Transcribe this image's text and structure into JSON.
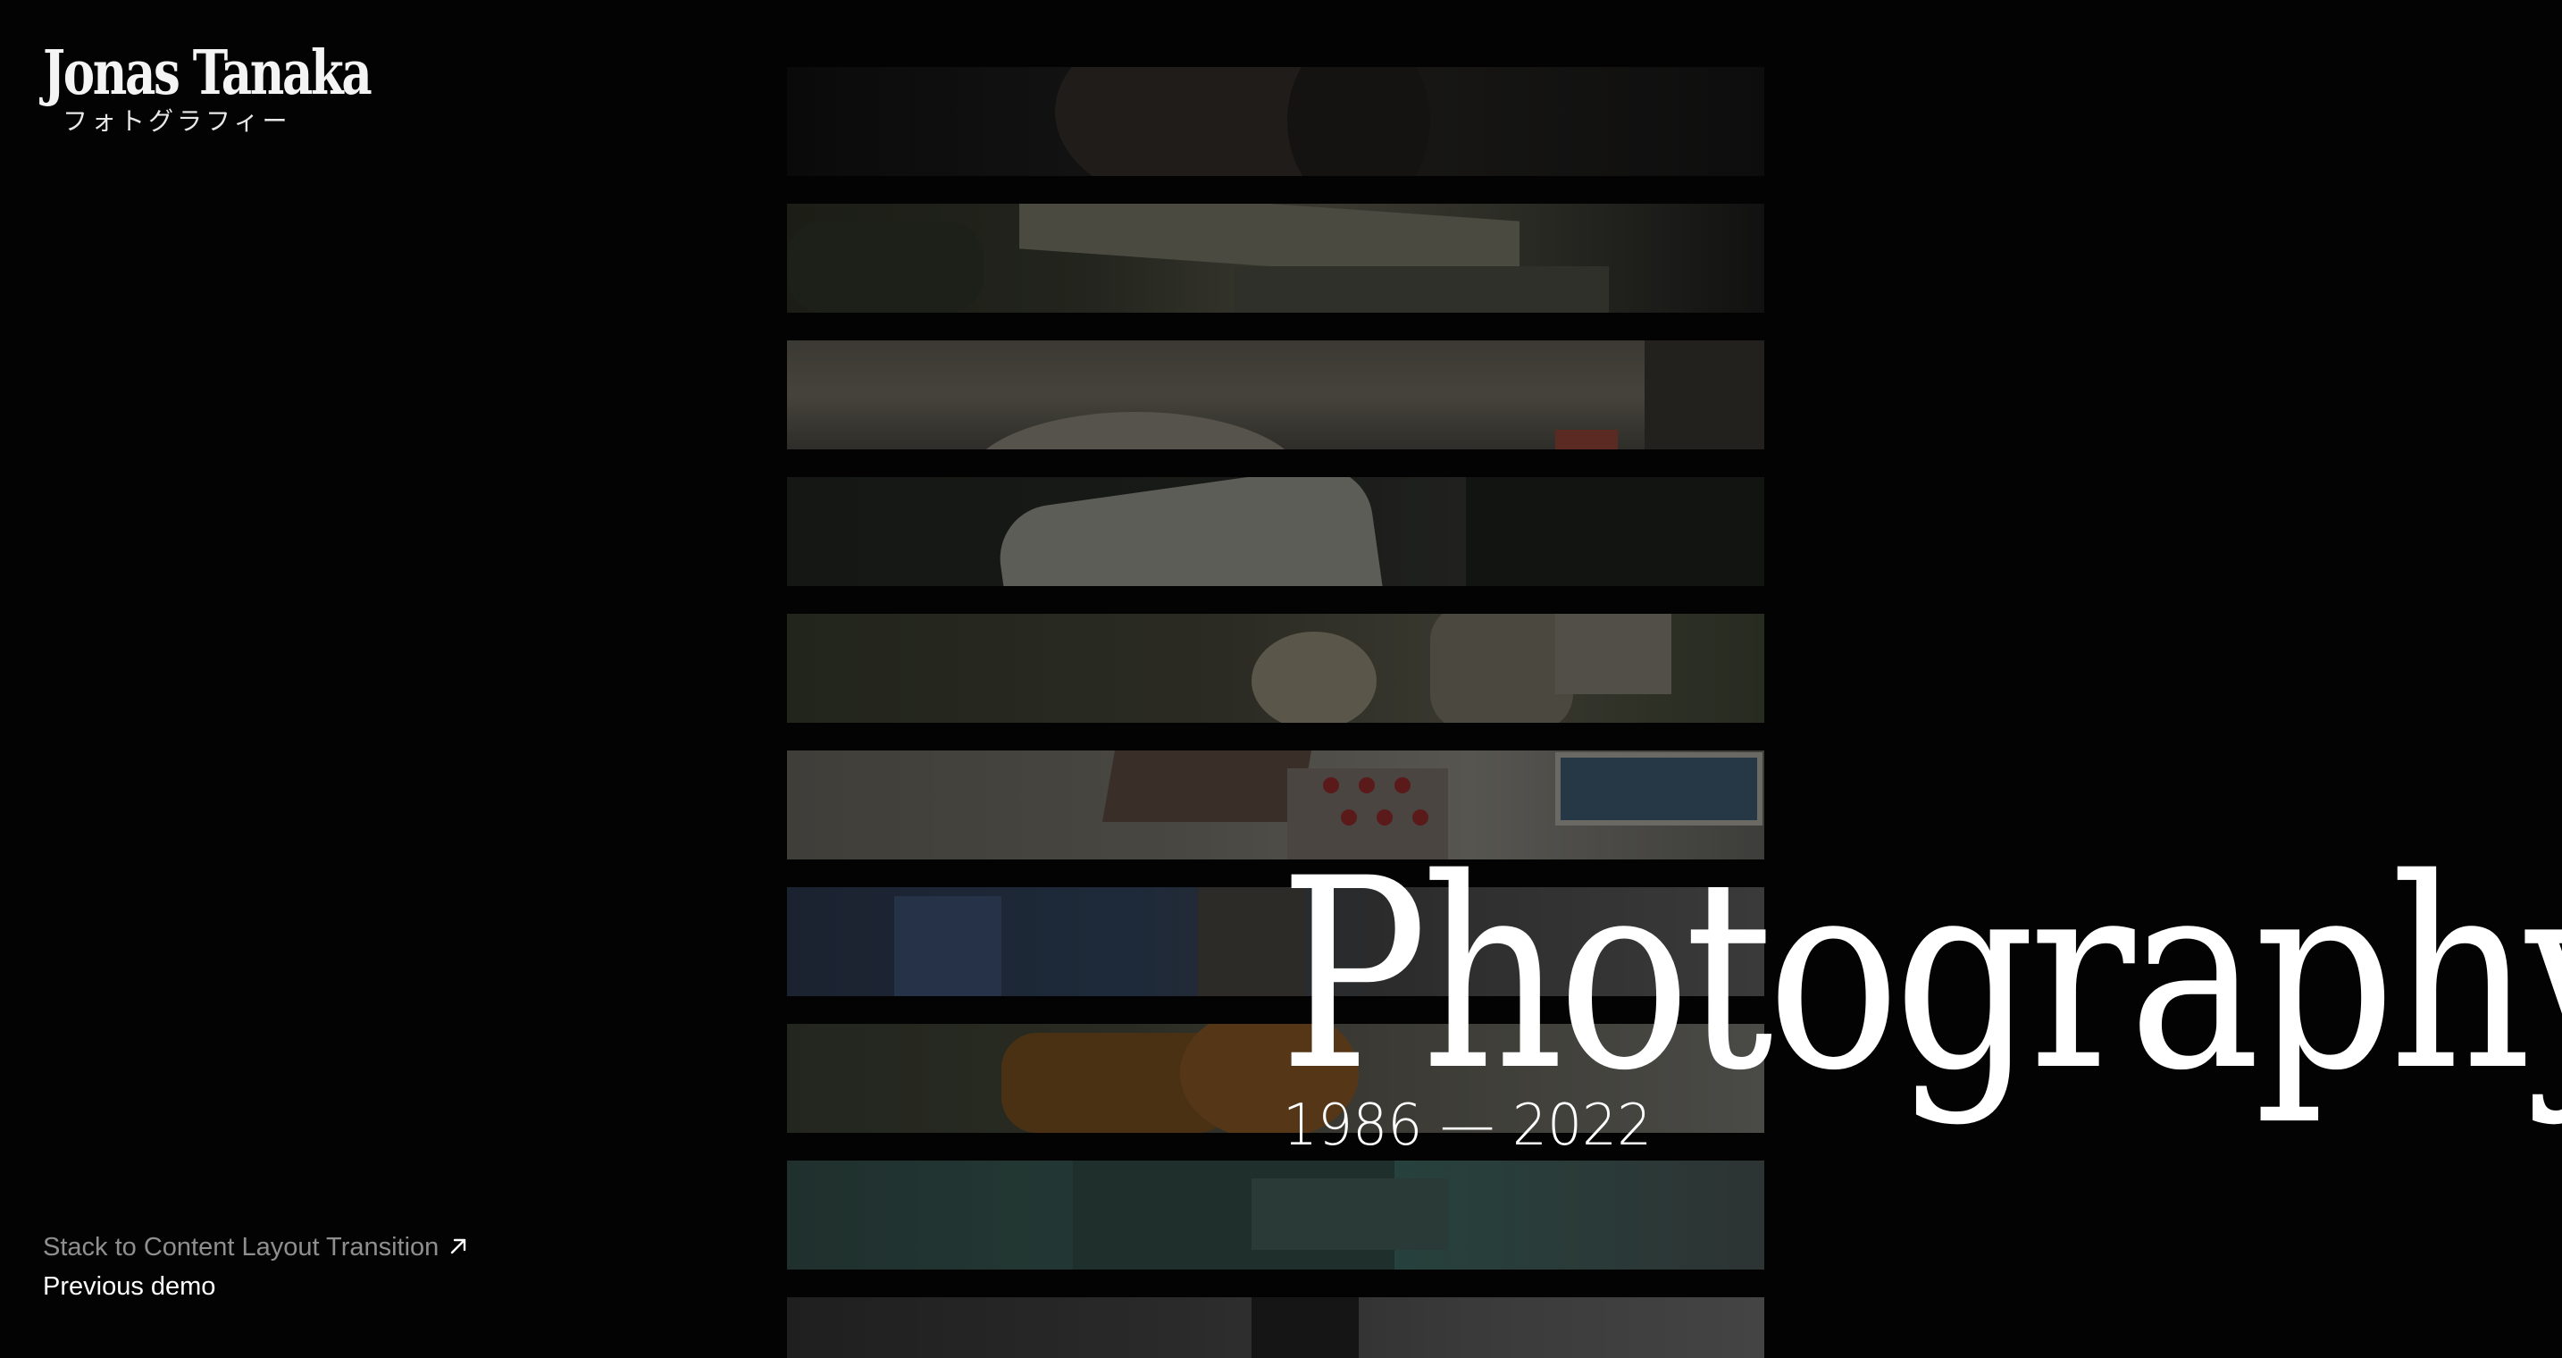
{
  "logo": {
    "name": "Jonas Tanaka",
    "subtitle": "フォトグラフィー"
  },
  "hero": {
    "title": "Photography",
    "years": "1986 — 2022"
  },
  "links": {
    "demo": "Stack to Content Layout Transition",
    "previous": "Previous demo"
  },
  "icons": {
    "demo_arrow": "arrow-up-right-icon"
  },
  "colors": {
    "background": "#030303",
    "text": "#ffffff",
    "muted_text": "#8f8f8f"
  }
}
